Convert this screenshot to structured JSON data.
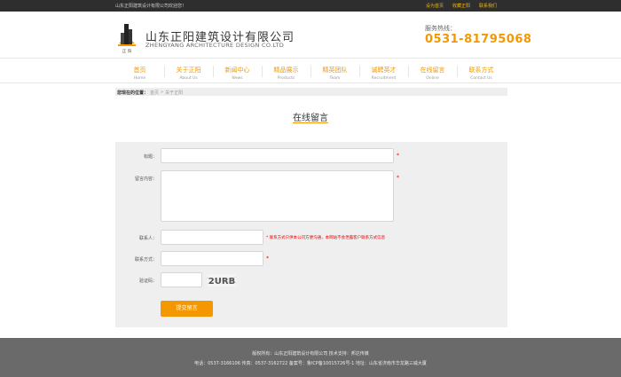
{
  "topbar": {
    "welcome": "山东正阳建筑设计有限公司欢迎您！",
    "links": [
      "设为首页",
      "收藏正阳",
      "联系我们"
    ]
  },
  "header": {
    "company_cn": "山东正阳建筑设计有限公司",
    "company_en": "ZHENGYANG ARCHITECTURE DESIGN CO.LTD",
    "logo_text": "正 阳",
    "hotline_label": "服务热线：",
    "hotline_number": "0531-81795068"
  },
  "nav": [
    {
      "cn": "首页",
      "en": "Home"
    },
    {
      "cn": "关于正阳",
      "en": "About Us"
    },
    {
      "cn": "新闻中心",
      "en": "News"
    },
    {
      "cn": "精品展示",
      "en": "Products"
    },
    {
      "cn": "精英团队",
      "en": "Team"
    },
    {
      "cn": "诚聘英才",
      "en": "Recruitment"
    },
    {
      "cn": "在线留言",
      "en": "Online"
    },
    {
      "cn": "联系方式",
      "en": "Contact Us"
    }
  ],
  "breadcrumb": {
    "label": "您现在的位置：",
    "home": "首页",
    "sep": "»",
    "current": "关于正阳"
  },
  "page_title": "在线留言",
  "form": {
    "title_label": "标题：",
    "content_label": "留言内容：",
    "contact_person_label": "联系人：",
    "contact_method_label": "联系方式：",
    "captcha_label": "验证码：",
    "required_mark": "*",
    "contact_hint": "* 联系方式只供本公司方便沟通，本网站不会泄露客户联系方式信息",
    "captcha_text": "2URB",
    "submit_label": "提交留言"
  },
  "footer": {
    "line1": "版权所有：山东正阳建筑设计有限公司    技术支持：邦达传媒",
    "line2": "电话：0537-3166106 传真：0537-3162722 备案号：鲁ICP备10015726号-1 地址：山东省济南市华龙路三威大厦"
  },
  "colors": {
    "accent": "#f39800",
    "topbar_bg": "#2e2e2e",
    "form_bg": "#efefef",
    "footer_bg": "#6a6a6a",
    "required": "#e00000"
  }
}
